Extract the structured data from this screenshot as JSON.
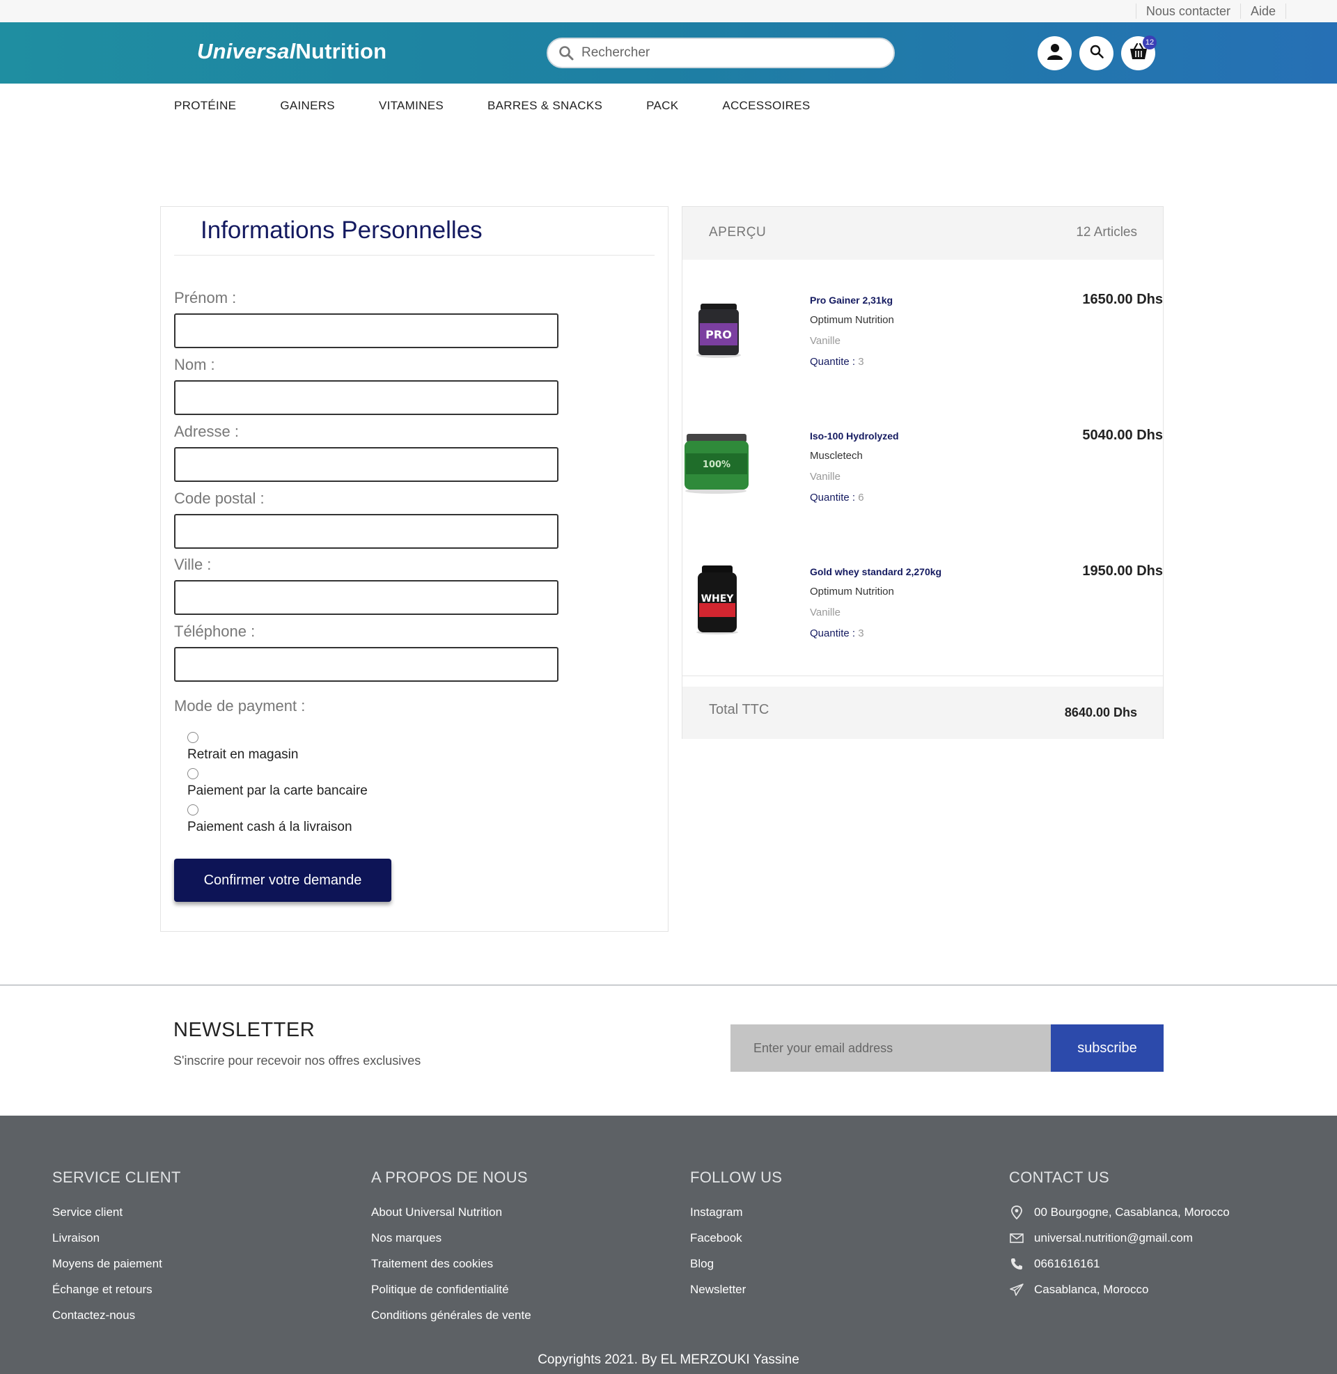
{
  "topbar": {
    "contact": "Nous contacter",
    "help": "Aide"
  },
  "header": {
    "logo_part1": "Universal",
    "logo_part2": "Nutrition",
    "search_placeholder": "Rechercher",
    "cart_count": "12",
    "icons": [
      "user-icon",
      "search-icon",
      "cart-icon"
    ]
  },
  "nav": [
    "PROTÉINE",
    "GAINERS",
    "VITAMINES",
    "BARRES & SNACKS",
    "PACK",
    "ACCESSOIRES"
  ],
  "form": {
    "title": "Informations Personnelles",
    "fields": [
      {
        "label": "Prénom :",
        "value": ""
      },
      {
        "label": "Nom :",
        "value": ""
      },
      {
        "label": "Adresse :",
        "value": ""
      },
      {
        "label": "Code postal :",
        "value": ""
      },
      {
        "label": "Ville :",
        "value": ""
      },
      {
        "label": "Téléphone :",
        "value": ""
      }
    ],
    "payment_label": "Mode de payment :",
    "payment_options": [
      "Retrait en magasin",
      "Paiement par la carte bancaire",
      "Paiement cash á la livraison"
    ],
    "confirm_label": "Confirmer votre demande"
  },
  "summary": {
    "title": "APERÇU",
    "count": "12 Articles",
    "items": [
      {
        "name": "Pro Gainer 2,31kg",
        "brand": "Optimum Nutrition",
        "flavor": "Vanille",
        "qty_label": "Quantite : ",
        "qty": "3",
        "price": "1650.00 Dhs",
        "tub_color": "#2a2a2e",
        "label_color": "#7b3fa0",
        "lid_color": "#1a1a1a"
      },
      {
        "name": "Iso-100 Hydrolyzed",
        "brand": "Muscletech",
        "flavor": "Vanille",
        "qty_label": "Quantite : ",
        "qty": "6",
        "price": "5040.00 Dhs",
        "tub_color": "#2f8a3a",
        "label_color": "#1f6d2a",
        "lid_color": "#444"
      },
      {
        "name": "Gold whey standard 2,270kg",
        "brand": "Optimum Nutrition",
        "flavor": "Vanille",
        "qty_label": "Quantite : ",
        "qty": "3",
        "price": "1950.00 Dhs",
        "tub_color": "#151515",
        "label_color": "#d22630",
        "lid_color": "#0e0e0e"
      }
    ],
    "total_label": "Total TTC",
    "total_value": "8640.00 Dhs"
  },
  "newsletter": {
    "title": "NEWSLETTER",
    "subtitle": "S'inscrire pour recevoir nos offres exclusives",
    "placeholder": "Enter your email address",
    "button": "subscribe"
  },
  "footer": {
    "service": {
      "title": "SERVICE CLIENT",
      "links": [
        "Service client",
        "Livraison",
        "Moyens de paiement",
        "Échange et retours",
        "Contactez-nous"
      ]
    },
    "about": {
      "title": "A PROPOS DE NOUS",
      "links": [
        "About Universal Nutrition",
        "Nos marques",
        "Traitement des cookies",
        "Politique de confidentialité",
        "Conditions générales de vente"
      ]
    },
    "follow": {
      "title": "FOLLOW US",
      "links": [
        "Instagram",
        "Facebook",
        "Blog",
        "Newsletter"
      ]
    },
    "contact": {
      "title": "CONTACT US",
      "address": "00 Bourgogne, Casablanca, Morocco",
      "email": "universal.nutrition@gmail.com",
      "phone": "0661616161",
      "city": "Casablanca, Morocco"
    },
    "copyright": "Copyrights 2021. By EL MERZOUKI Yassine"
  },
  "colors": {
    "brand_navy": "#0d1456",
    "header_start": "#1f8ea1",
    "header_end": "#2670b5",
    "subscribe": "#2c4aab",
    "footer_bg": "#5d6165"
  }
}
